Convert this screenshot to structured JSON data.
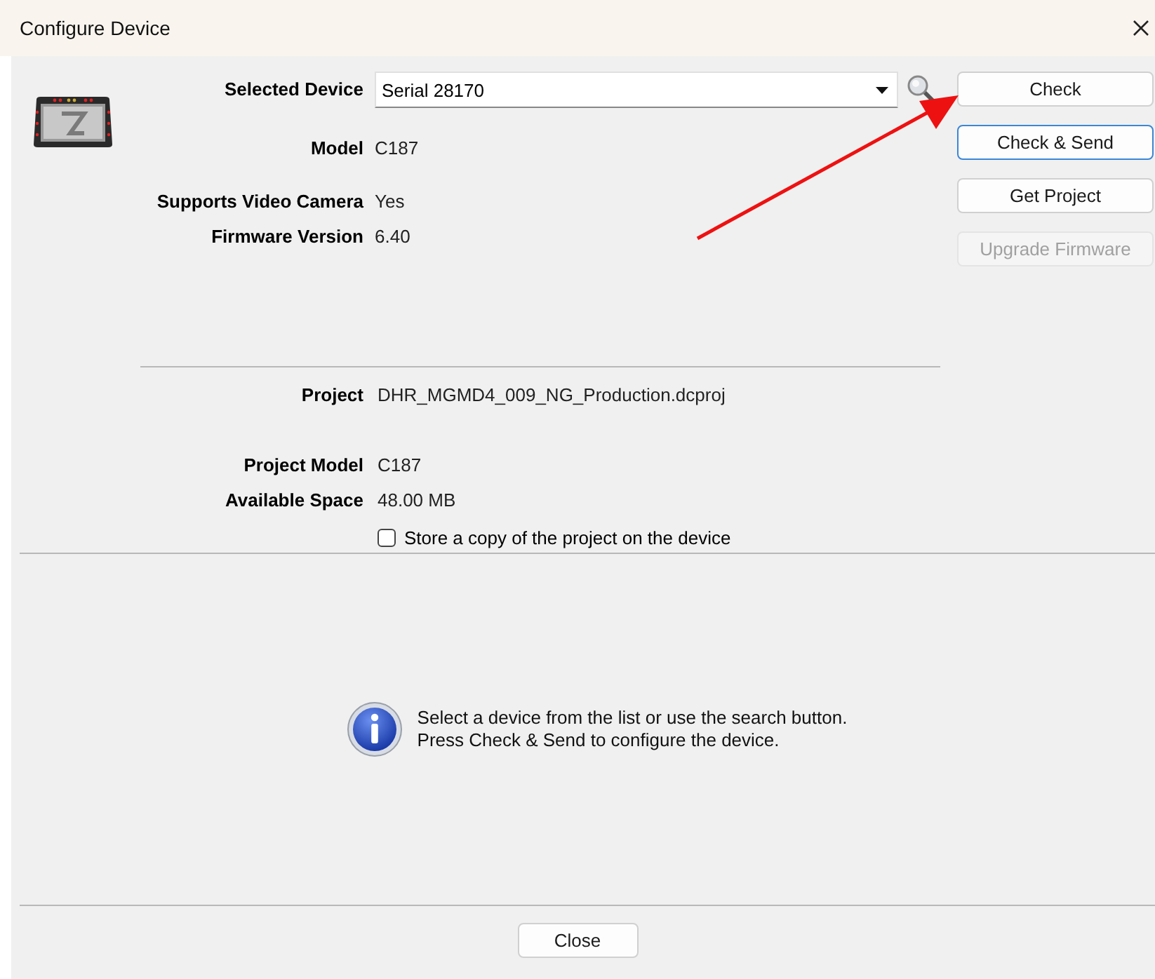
{
  "window": {
    "title": "Configure Device"
  },
  "device": {
    "fields": [
      {
        "label": "Selected Device",
        "value": "Serial 28170",
        "kind": "dropdown"
      },
      {
        "label": "Model",
        "value": "C187",
        "kind": "text"
      },
      {
        "label": "Supports Video Camera",
        "value": "Yes",
        "kind": "text"
      },
      {
        "label": "Firmware Version",
        "value": "6.40",
        "kind": "text"
      }
    ]
  },
  "buttons": [
    {
      "label": "Check",
      "focused": false,
      "disabled": false
    },
    {
      "label": "Check & Send",
      "focused": true,
      "disabled": false
    },
    {
      "label": "Get Project",
      "focused": false,
      "disabled": false
    },
    {
      "label": "Upgrade Firmware",
      "focused": false,
      "disabled": true
    }
  ],
  "project": {
    "fields": [
      {
        "label": "Project",
        "value": "DHR_MGMD4_009_NG_Production.dcproj"
      },
      {
        "label": "Project Model",
        "value": "C187"
      },
      {
        "label": "Available Space",
        "value": "48.00 MB"
      }
    ],
    "checkbox": {
      "label": "Store a copy of the project on the device",
      "checked": false
    }
  },
  "info": {
    "message": "Select a device from the list or use the search button.\nPress Check & Send to configure the device."
  },
  "footer": {
    "button": "Close"
  },
  "annotation": {
    "kind": "arrow"
  }
}
